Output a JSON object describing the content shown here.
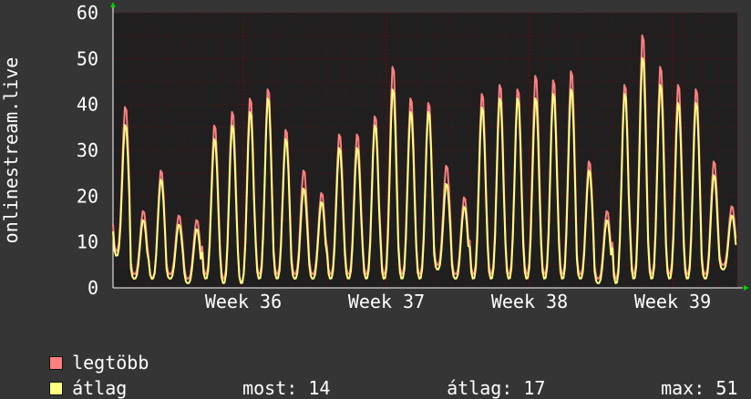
{
  "chart_data": {
    "type": "line",
    "ylabel": "onlinestream.live",
    "ylim": [
      0,
      60
    ],
    "yticks": [
      "0",
      "10",
      "20",
      "30",
      "40",
      "50",
      "60"
    ],
    "xticks": [
      "Week 36",
      "Week 37",
      "Week 38",
      "Week 39"
    ],
    "grid": true,
    "series": [
      {
        "name": "legtöbb",
        "color": "#ff7f7f",
        "daily_peaks": [
          40,
          17,
          26,
          16,
          15,
          36,
          39,
          42,
          44,
          35,
          26,
          21,
          34,
          34,
          38,
          49,
          42,
          41,
          27,
          20,
          43,
          45,
          44,
          47,
          46,
          48,
          28,
          17,
          45,
          56,
          49,
          45,
          44,
          28,
          18
        ],
        "daily_troughs": [
          8,
          3,
          2,
          3,
          2,
          3,
          2,
          1,
          3,
          3,
          3,
          3,
          3,
          3,
          3,
          3,
          3,
          3,
          5,
          3,
          3,
          3,
          3,
          3,
          3,
          3,
          3,
          2,
          2,
          3,
          3,
          3,
          3,
          3,
          5
        ]
      },
      {
        "name": "átlag",
        "color": "#ffff7f",
        "daily_peaks": [
          36,
          15,
          24,
          14,
          13,
          33,
          36,
          39,
          42,
          33,
          22,
          19,
          31,
          31,
          36,
          44,
          39,
          39,
          23,
          18,
          40,
          42,
          42,
          42,
          43,
          44,
          26,
          15,
          43,
          51,
          45,
          41,
          41,
          25,
          16
        ],
        "daily_troughs": [
          7,
          2,
          2,
          2,
          1,
          2,
          1,
          1,
          2,
          2,
          2,
          2,
          2,
          2,
          2,
          2,
          2,
          2,
          4,
          2,
          2,
          2,
          2,
          2,
          2,
          2,
          2,
          1,
          1,
          2,
          2,
          2,
          2,
          2,
          4
        ]
      }
    ],
    "legend_position": "bottom-left"
  },
  "legend": {
    "max_label": "legtöbb",
    "avg_label": "átlag",
    "now_label": "most:",
    "now_value": "14",
    "avg_stat_label": "átlag:",
    "avg_stat_value": "17",
    "max_stat_label": "max:",
    "max_stat_value": "51"
  },
  "colors": {
    "background": "#353535",
    "plot_background": "#1f1f1f",
    "grid": "#8b0000",
    "text": "#ffffff",
    "axis_arrow": "#00cc00"
  }
}
